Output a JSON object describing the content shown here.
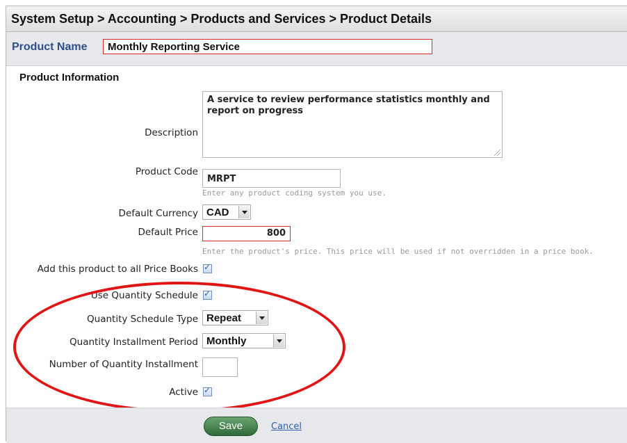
{
  "header": {
    "breadcrumb": "System Setup > Accounting > Products and Services > Product Details"
  },
  "product": {
    "name_label": "Product Name",
    "name_value": "Monthly Reporting Service"
  },
  "section": {
    "title": "Product Information"
  },
  "form": {
    "description": {
      "label": "Description",
      "value": "A service to review performance statistics monthly and report on progress"
    },
    "product_code": {
      "label": "Product Code",
      "value": "MRPT",
      "hint": "Enter any product coding system you use."
    },
    "default_currency": {
      "label": "Default Currency",
      "value": "CAD"
    },
    "default_price": {
      "label": "Default Price",
      "value": "800",
      "hint": "Enter the product's price. This price will be used if not overridden in a price book."
    },
    "add_to_price_books": {
      "label": "Add this product to all Price Books",
      "checked": true
    },
    "use_quantity_schedule": {
      "label": "Use Quantity Schedule",
      "checked": true
    },
    "quantity_schedule_type": {
      "label": "Quantity Schedule Type",
      "value": "Repeat"
    },
    "quantity_installment_period": {
      "label": "Quantity Installment Period",
      "value": "Monthly"
    },
    "number_of_installments": {
      "label": "Number of Quantity Installment",
      "value": ""
    },
    "active": {
      "label": "Active",
      "checked": true
    }
  },
  "actions": {
    "save_label": "Save",
    "cancel_label": "Cancel"
  },
  "icons": {
    "checkbox_checked": "checkmark-icon",
    "dropdown": "chevron-down-icon",
    "resize_handle": "resize-grip-icon"
  },
  "colors": {
    "highlight_circle": "#e01515",
    "required_border": "#e02a2a",
    "label_blue": "#2f4f86",
    "save_green": "#2f6a3a",
    "link_blue": "#2f5fa6"
  }
}
